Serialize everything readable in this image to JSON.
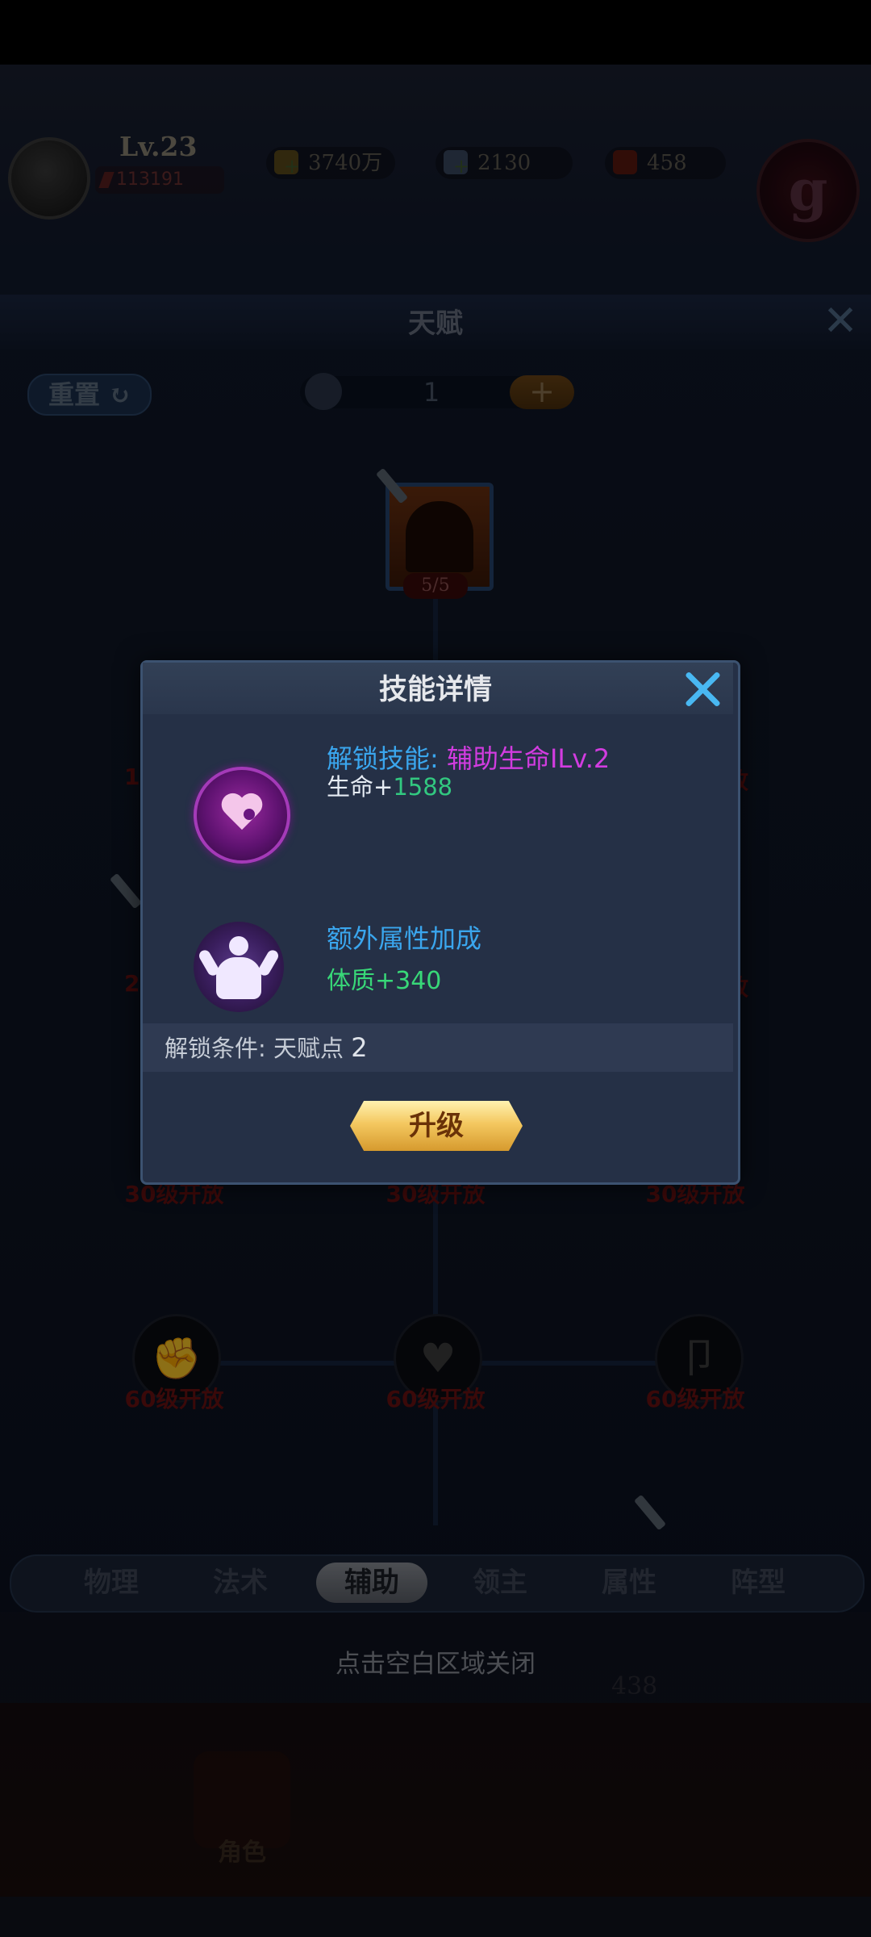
{
  "player": {
    "level": "Lv.23",
    "power": "113191",
    "gold": "3740万",
    "diamonds": "2130",
    "tickets": "458"
  },
  "talent_panel": {
    "title": "天赋",
    "reset_label": "重置",
    "points": "1",
    "add_label": "+",
    "top_node_progress": "5/5",
    "locked_labels": [
      "30级开放",
      "30级开放",
      "30级开放",
      "60级开放",
      "60级开放",
      "60级开放"
    ],
    "partial_labels": {
      "left_1": "1",
      "left_2": "2",
      "right_1": "放",
      "right_2": "放"
    }
  },
  "tabs": [
    {
      "label": "物理",
      "active": false
    },
    {
      "label": "法术",
      "active": false
    },
    {
      "label": "辅助",
      "active": true
    },
    {
      "label": "领主",
      "active": false
    },
    {
      "label": "属性",
      "active": false
    },
    {
      "label": "阵型",
      "active": false
    }
  ],
  "tap_hint": "点击空白区域关闭",
  "background_number": "438",
  "footer_labels": [
    "角色"
  ],
  "modal": {
    "title": "技能详情",
    "unlock_prefix": "解锁技能: ",
    "unlock_skill": "辅助生命ⅠLv.2",
    "hp_prefix": "生命+",
    "hp_value": "1588",
    "bonus_title": "额外属性加成",
    "vitality": "体质+340",
    "condition_label": "解锁条件: 天赋点 ",
    "condition_value": "2",
    "upgrade_label": "升级"
  },
  "colors": {
    "accent_blue": "#3aa6ee",
    "skill_purple": "#d23ce0",
    "value_green": "#32c880",
    "button_gold": "#f4c860",
    "locked_red": "#6b1212"
  },
  "icons": [
    "avatar",
    "gold-icon",
    "diamond-icon",
    "ticket-icon",
    "emblem-icon",
    "shield-icon",
    "heart-skill-icon",
    "body-attribute-icon",
    "fist-icon",
    "close-icon"
  ]
}
